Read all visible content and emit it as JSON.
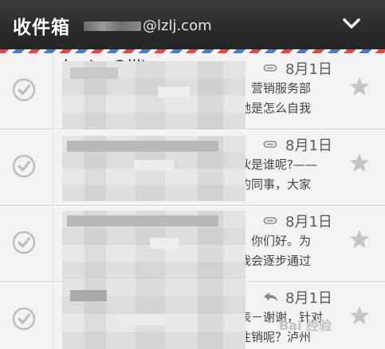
{
  "header": {
    "title": "收件箱",
    "account_suffix": "@lzlj.com"
  },
  "messages": [
    {
      "sender": "h...ter@ijlt...",
      "indicator": "attachment",
      "date": "8月1日",
      "snippet1": "：营销服务部",
      "snippet2": "她是怎么自我"
    },
    {
      "sender": "",
      "indicator": "attachment",
      "date": "8月1日",
      "snippet1": "伙是谁呢?——",
      "snippet2": "的同事，大家"
    },
    {
      "sender": "",
      "indicator": "attachment",
      "date": "8月1日",
      "snippet1": "：你们好。为",
      "snippet2": "我会逐步通过"
    },
    {
      "sender": "",
      "indicator": "reply",
      "date": "8月1日",
      "snippet1": "表－谢谢，针对",
      "snippet2": "注销呢？泸州"
    }
  ],
  "watermark": "Bai 经验",
  "colors": {
    "header_bg": "#2a2a2a",
    "header_text": "#ffffff",
    "list_bg": "#f3f3f3",
    "star": "#bdbdbd",
    "check": "#bdbdbd"
  }
}
